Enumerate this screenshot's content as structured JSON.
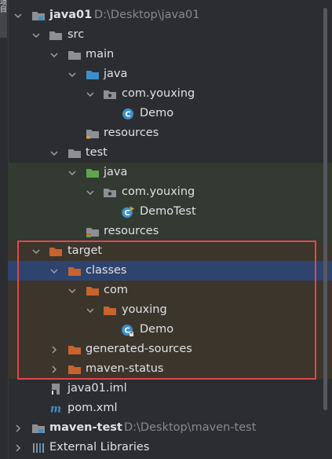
{
  "gutter": {
    "tab_label": "项目"
  },
  "tree": {
    "java01": {
      "name": "java01",
      "path": "D:\\Desktop\\java01"
    },
    "src": "src",
    "main": "main",
    "main_java": "java",
    "main_pkg": "com.youxing",
    "main_demo": "Demo",
    "main_resources": "resources",
    "test": "test",
    "test_java": "java",
    "test_pkg": "com.youxing",
    "test_demo": "DemoTest",
    "test_resources": "resources",
    "target": "target",
    "classes": "classes",
    "com": "com",
    "youxing": "youxing",
    "class_demo": "Demo",
    "generated_sources": "generated-sources",
    "maven_status": "maven-status",
    "iml": "java01.iml",
    "pom": "pom.xml",
    "maven_test": {
      "name": "maven-test",
      "path": "D:\\Desktop\\maven-test"
    },
    "external_libraries": "External Libraries"
  },
  "colors": {
    "selection": "#2e436e",
    "test_highlight": "#323a31",
    "excluded_highlight": "#3b352c",
    "annotation_box": "#e0474b",
    "source_folder": "#3d8fc9",
    "test_folder": "#5fa54d",
    "excluded_folder": "#c7632d",
    "plain_folder": "#8c9095",
    "class_icon": "#3d8fc9"
  }
}
